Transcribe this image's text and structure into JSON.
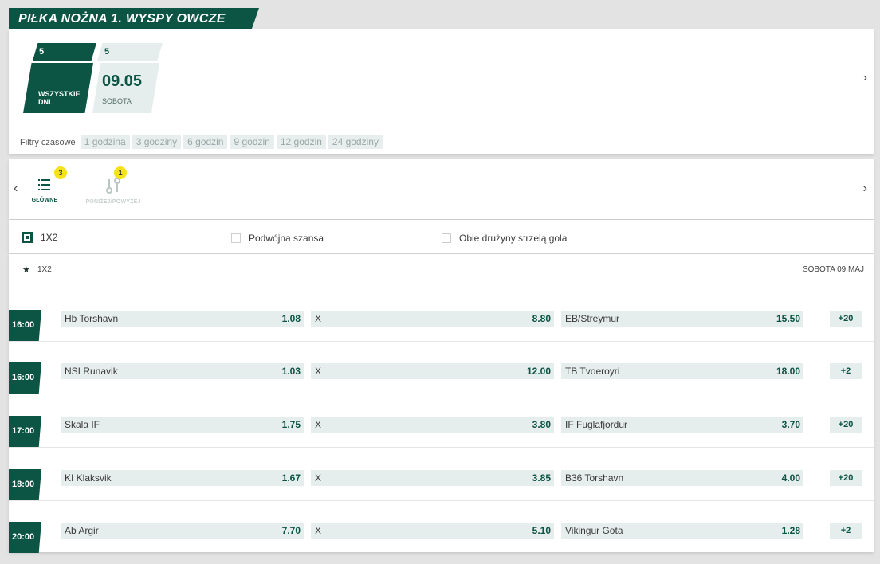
{
  "header": {
    "title": "PIŁKA NOŻNA 1. WYSPY OWCZE"
  },
  "days": [
    {
      "count": "5",
      "label": "WSZYSTKIE DNI"
    },
    {
      "count": "5",
      "date": "09.05",
      "label": "SOBOTA"
    }
  ],
  "filters": {
    "label": "Filtry czasowe",
    "options": [
      "1 godzina",
      "3 godziny",
      "6 godzin",
      "9 godzin",
      "12 godzin",
      "24 godziny"
    ]
  },
  "market_tabs": [
    {
      "label": "GŁÓWNE",
      "badge": "3",
      "icon": "list-icon"
    },
    {
      "label": "PONIŻEJ/POWYŻEJ",
      "badge": "1",
      "icon": "over-under-icon"
    }
  ],
  "market_checks": [
    {
      "label": "1X2",
      "checked": true
    },
    {
      "label": "Podwójna szansa",
      "checked": false
    },
    {
      "label": "Obie drużyny strzelą gola",
      "checked": false
    }
  ],
  "list": {
    "market": "1X2",
    "date": "SOBOTA 09 Maj"
  },
  "draw_label": "X",
  "matches": [
    {
      "time": "16:00",
      "home": "Hb Torshavn",
      "home_odd": "1.08",
      "draw_odd": "8.80",
      "away": "EB/Streymur",
      "away_odd": "15.50",
      "more": "+20"
    },
    {
      "time": "16:00",
      "home": "NSI Runavik",
      "home_odd": "1.03",
      "draw_odd": "12.00",
      "away": "TB Tvoeroyri",
      "away_odd": "18.00",
      "more": "+2"
    },
    {
      "time": "17:00",
      "home": "Skala IF",
      "home_odd": "1.75",
      "draw_odd": "3.80",
      "away": "IF Fuglafjordur",
      "away_odd": "3.70",
      "more": "+20"
    },
    {
      "time": "18:00",
      "home": "KI Klaksvik",
      "home_odd": "1.67",
      "draw_odd": "3.85",
      "away": "B36 Torshavn",
      "away_odd": "4.00",
      "more": "+20"
    },
    {
      "time": "20:00",
      "home": "Ab Argir",
      "home_odd": "7.70",
      "draw_odd": "5.10",
      "away": "Vikingur Gota",
      "away_odd": "1.28",
      "more": "+2"
    }
  ],
  "colors": {
    "brand": "#0c5444",
    "chip": "#e6eded",
    "badge": "#f5e21b"
  }
}
